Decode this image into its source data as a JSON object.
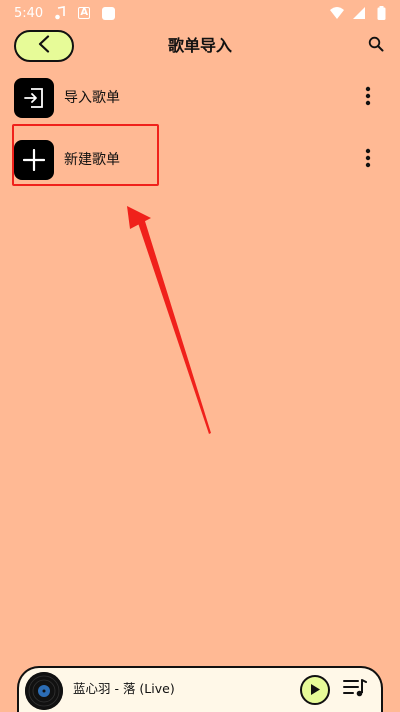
{
  "status_bar": {
    "time": "5:40",
    "icons": [
      "music-note-icon",
      "text-a-icon",
      "app-square-icon",
      "wifi-icon",
      "cell-signal-icon",
      "battery-icon"
    ]
  },
  "header": {
    "title": "歌单导入",
    "back_icon": "chevron-left-icon",
    "search_icon": "search-icon"
  },
  "list": {
    "items": [
      {
        "label": "导入歌单",
        "icon": "import-icon",
        "more_icon": "more-vertical-icon"
      },
      {
        "label": "新建歌单",
        "icon": "plus-icon",
        "more_icon": "more-vertical-icon"
      }
    ]
  },
  "player": {
    "song": "蓝心羽 - 落 (Live)",
    "play_icon": "play-icon",
    "playlist_icon": "playlist-icon"
  },
  "colors": {
    "background": "#FFB994",
    "accent": "#E7FB98",
    "annotation": "#F0211B",
    "icon_tile": "#000000"
  }
}
